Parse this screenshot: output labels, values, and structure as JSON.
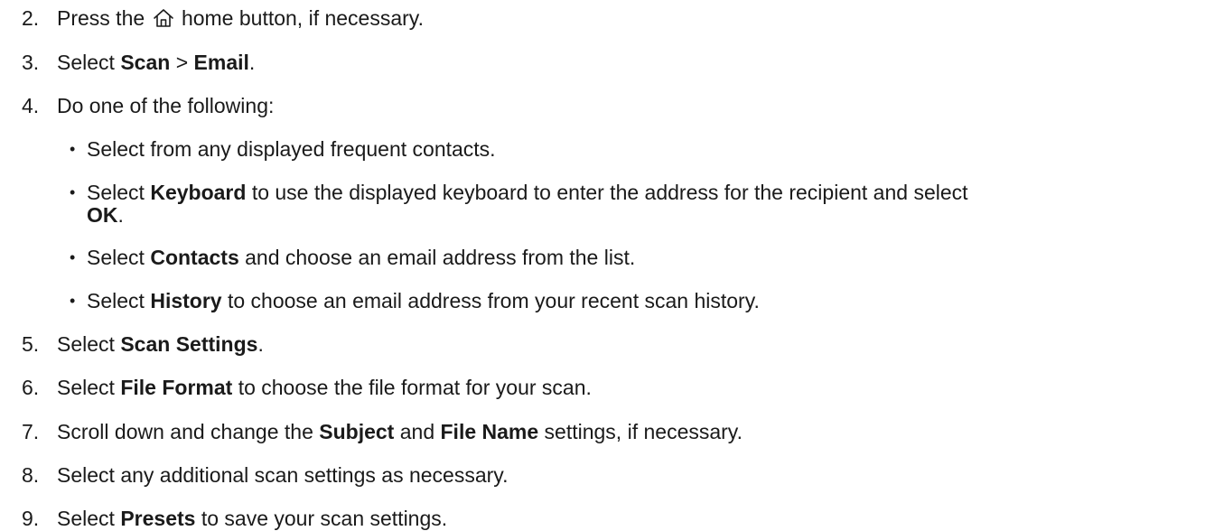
{
  "steps": [
    {
      "number": "2.",
      "part1": "Press the",
      "icon": "home-icon",
      "part2": "home button, if necessary."
    },
    {
      "number": "3.",
      "part1": "Select",
      "bold1": "Scan",
      "part2": ">",
      "bold2": "Email",
      "part3": "."
    },
    {
      "number": "4.",
      "text": "Do one of the following:",
      "bullets": [
        {
          "dot": "•",
          "text": "Select from any displayed frequent contacts."
        },
        {
          "dot": "•",
          "part1": "Select",
          "bold1": "Keyboard",
          "part2": "to use the displayed keyboard to enter the address for the recipient and select",
          "bold2": "OK",
          "part3": "."
        },
        {
          "dot": "•",
          "part1": "Select",
          "bold1": "Contacts",
          "part2": "and choose an email address from the list."
        },
        {
          "dot": "•",
          "part1": "Select",
          "bold1": "History",
          "part2": "to choose an email address from your recent scan history."
        }
      ]
    },
    {
      "number": "5.",
      "part1": "Select",
      "bold1": "Scan Settings",
      "part2": "."
    },
    {
      "number": "6.",
      "part1": "Select",
      "bold1": "File Format",
      "part2": "to choose the file format for your scan."
    },
    {
      "number": "7.",
      "part1": "Scroll down and change the",
      "bold1": "Subject",
      "part2": "and",
      "bold2": "File Name",
      "part3": "settings, if necessary."
    },
    {
      "number": "8.",
      "text": "Select any additional scan settings as necessary."
    },
    {
      "number": "9.",
      "part1": "Select",
      "bold1": "Presets",
      "part2": "to save your scan settings."
    }
  ]
}
